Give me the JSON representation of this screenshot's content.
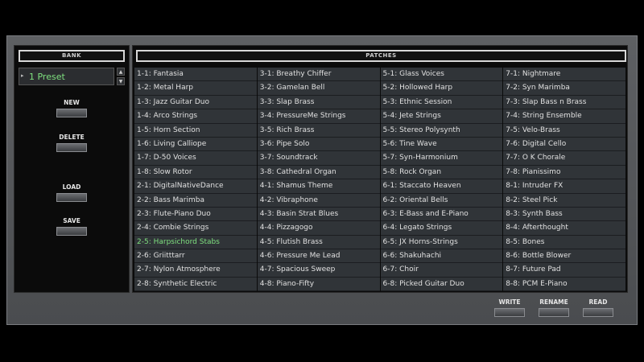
{
  "bank": {
    "header": "BANK",
    "preset": "1 Preset",
    "buttons": {
      "new": "NEW",
      "delete": "DELETE",
      "load": "LOAD",
      "save": "SAVE"
    }
  },
  "patches": {
    "header": "PATCHES",
    "selected": "2-5",
    "columns": [
      [
        "1-1: Fantasia",
        "1-2: Metal Harp",
        "1-3: Jazz Guitar Duo",
        "1-4: Arco Strings",
        "1-5: Horn Section",
        "1-6: Living Calliope",
        "1-7: D-50 Voices",
        "1-8: Slow Rotor",
        "2-1: DigitalNativeDance",
        "2-2: Bass Marimba",
        "2-3: Flute-Piano Duo",
        "2-4: Combie Strings",
        "2-5: Harpsichord Stabs",
        "2-6: Griitttarr",
        "2-7: Nylon Atmosphere",
        "2-8: Synthetic Electric"
      ],
      [
        "3-1: Breathy Chiffer",
        "3-2: Gamelan Bell",
        "3-3: Slap Brass",
        "3-4: PressureMe Strings",
        "3-5: Rich Brass",
        "3-6: Pipe Solo",
        "3-7: Soundtrack",
        "3-8: Cathedral Organ",
        "4-1: Shamus Theme",
        "4-2: Vibraphone",
        "4-3: Basin Strat Blues",
        "4-4: Pizzagogo",
        "4-5: Flutish Brass",
        "4-6: Pressure Me Lead",
        "4-7: Spacious Sweep",
        "4-8: Piano-Fifty"
      ],
      [
        "5-1: Glass Voices",
        "5-2: Hollowed Harp",
        "5-3: Ethnic Session",
        "5-4: Jete Strings",
        "5-5: Stereo Polysynth",
        "5-6: Tine Wave",
        "5-7: Syn-Harmonium",
        "5-8: Rock Organ",
        "6-1: Staccato Heaven",
        "6-2: Oriental Bells",
        "6-3: E-Bass and E-Piano",
        "6-4: Legato Strings",
        "6-5: JX Horns-Strings",
        "6-6: Shakuhachi",
        "6-7: Choir",
        "6-8: Picked Guitar Duo"
      ],
      [
        "7-1: Nightmare",
        "7-2: Syn Marimba",
        "7-3: Slap Bass n Brass",
        "7-4: String Ensemble",
        "7-5: Velo-Brass",
        "7-6: Digital Cello",
        "7-7: O K  Chorale",
        "7-8: Pianissimo",
        "8-1: Intruder FX",
        "8-2: Steel Pick",
        "8-3: Synth Bass",
        "8-4: Afterthought",
        "8-5: Bones",
        "8-6: Bottle Blower",
        "8-7: Future Pad",
        "8-8: PCM E-Piano"
      ]
    ]
  },
  "footer": {
    "write": "WRITE",
    "rename": "RENAME",
    "read": "READ"
  },
  "colors": {
    "selected": "#7fe07f",
    "cell_bg": "#303438",
    "text": "#e0e0e0"
  }
}
